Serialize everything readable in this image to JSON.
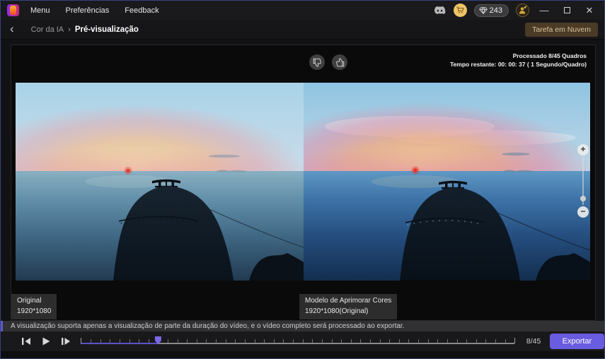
{
  "titlebar": {
    "menu": [
      {
        "label": "Menu"
      },
      {
        "label": "Preferências"
      },
      {
        "label": "Feedback"
      }
    ],
    "credits": "243",
    "window_buttons": {
      "minimize": "—",
      "close": "✕"
    }
  },
  "nav": {
    "back_glyph": "‹",
    "breadcrumb": {
      "parent": "Cor da IA",
      "separator": "›",
      "current": "Pré-visualização"
    },
    "cloud_task_button": "Tarefa em Nuvem"
  },
  "preview": {
    "progress": {
      "line1": "Processado 8/45 Quadros",
      "line2": "Tempo restante: 00: 00: 37 ( 1 Segundo/Quadro)"
    },
    "original_label": {
      "title": "Original",
      "resolution": "1920*1080"
    },
    "enhanced_label": {
      "title": "Modelo de Aprimorar Cores",
      "resolution": "1920*1080(Original)"
    },
    "zoom": {
      "in_glyph": "+",
      "out_glyph": "−"
    }
  },
  "infobar": {
    "message": "A visualização suporta apenas a visualização de parte da duração do vídeo, e o vídeo completo será processado ao exportar."
  },
  "controls": {
    "frame_counter": "8/45",
    "current_frame": 8,
    "total_frames": 45,
    "export_label": "Exportar"
  },
  "colors": {
    "accent_purple": "#6a5ce0",
    "progress_fill": "#5b52cc",
    "cloud_button_bg": "#4a3a26",
    "cloud_button_text": "#d9c49e",
    "credit_gold": "#eec566",
    "infobar_accent": "#6058c8",
    "window_border": "#566cd6"
  }
}
